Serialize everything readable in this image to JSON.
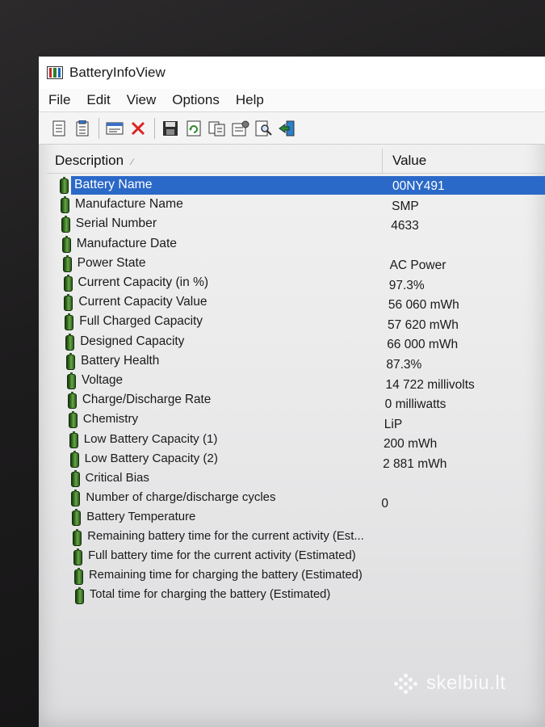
{
  "window": {
    "title": "BatteryInfoView"
  },
  "menu": [
    "File",
    "Edit",
    "View",
    "Options",
    "Help"
  ],
  "toolbar": {
    "icons": [
      "html-report-icon",
      "report-icon",
      "properties-icon",
      "delete-icon",
      "save-icon",
      "refresh-icon",
      "copy-icon",
      "options-icon",
      "find-icon",
      "exit-icon"
    ]
  },
  "columns": {
    "description": "Description",
    "value": "Value"
  },
  "rows": [
    {
      "description": "Battery Name",
      "value": "00NY491"
    },
    {
      "description": "Manufacture Name",
      "value": "SMP"
    },
    {
      "description": "Serial Number",
      "value": "4633"
    },
    {
      "description": "Manufacture Date",
      "value": ""
    },
    {
      "description": "Power State",
      "value": "AC Power"
    },
    {
      "description": "Current Capacity (in %)",
      "value": "97.3%"
    },
    {
      "description": "Current Capacity Value",
      "value": "56 060 mWh"
    },
    {
      "description": "Full Charged Capacity",
      "value": "57 620 mWh"
    },
    {
      "description": "Designed Capacity",
      "value": "66 000 mWh"
    },
    {
      "description": "Battery Health",
      "value": "87.3%"
    },
    {
      "description": "Voltage",
      "value": "14 722 millivolts"
    },
    {
      "description": "Charge/Discharge Rate",
      "value": "0 milliwatts"
    },
    {
      "description": "Chemistry",
      "value": "LiP"
    },
    {
      "description": "Low Battery Capacity (1)",
      "value": "200 mWh"
    },
    {
      "description": "Low Battery Capacity (2)",
      "value": "2 881 mWh"
    },
    {
      "description": "Critical Bias",
      "value": ""
    },
    {
      "description": "Number of charge/discharge cycles",
      "value": "0"
    },
    {
      "description": "Battery Temperature",
      "value": ""
    },
    {
      "description": "Remaining battery time for the current activity (Est...",
      "value": ""
    },
    {
      "description": "Full battery time for the current activity (Estimated)",
      "value": ""
    },
    {
      "description": "Remaining time for charging the battery (Estimated)",
      "value": ""
    },
    {
      "description": "Total  time for charging the battery (Estimated)",
      "value": ""
    }
  ],
  "watermark": "skelbiu.lt"
}
